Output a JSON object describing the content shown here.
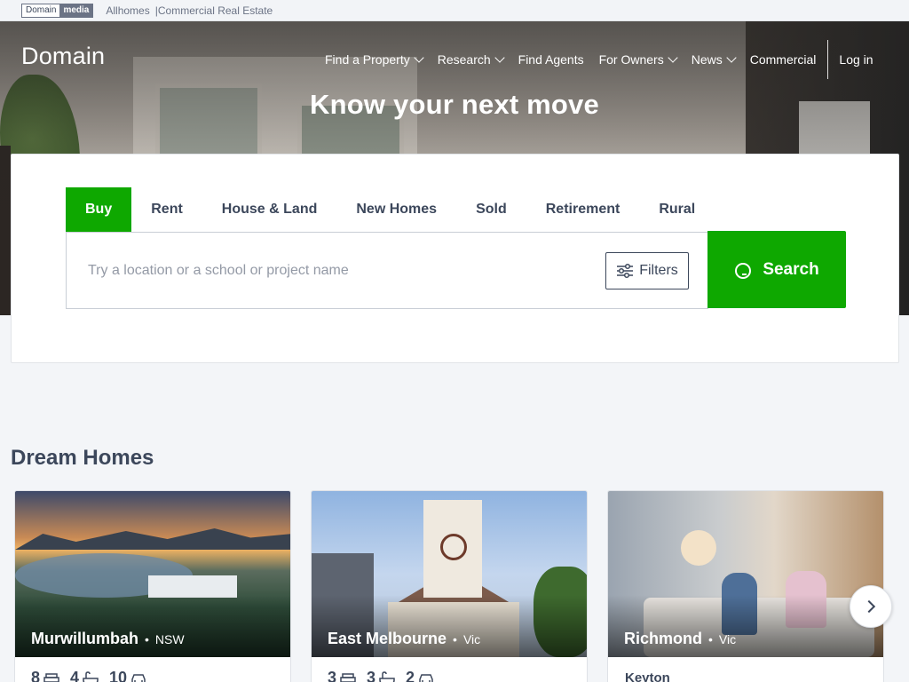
{
  "topbar": {
    "logo_left": "Domain",
    "logo_right": "media",
    "links": [
      "Allhomes",
      "Commercial Real Estate"
    ]
  },
  "header": {
    "brand": "Domain",
    "nav": [
      {
        "label": "Find a Property"
      },
      {
        "label": "Research"
      },
      {
        "label": "Find Agents"
      },
      {
        "label": "For Owners"
      },
      {
        "label": "News"
      },
      {
        "label": "Commercial"
      }
    ],
    "login": "Log in"
  },
  "hero": {
    "headline": "Know your next move"
  },
  "search": {
    "tabs": [
      "Buy",
      "Rent",
      "House & Land",
      "New Homes",
      "Sold",
      "Retirement",
      "Rural"
    ],
    "active_tab": "Buy",
    "placeholder": "Try a location or a school or project name",
    "filters_label": "Filters",
    "search_label": "Search"
  },
  "dream_homes": {
    "title": "Dream Homes",
    "cards": [
      {
        "suburb": "Murwillumbah",
        "state": "NSW",
        "beds": "8",
        "baths": "4",
        "parking": "10"
      },
      {
        "suburb": "East Melbourne",
        "state": "Vic",
        "beds": "3",
        "baths": "3",
        "parking": "2"
      },
      {
        "suburb": "Richmond",
        "state": "Vic",
        "agent": "Keyton"
      }
    ]
  },
  "colors": {
    "accent_green": "#0ea800",
    "text_dark": "#3c475b",
    "page_bg": "#f3f5f8"
  }
}
